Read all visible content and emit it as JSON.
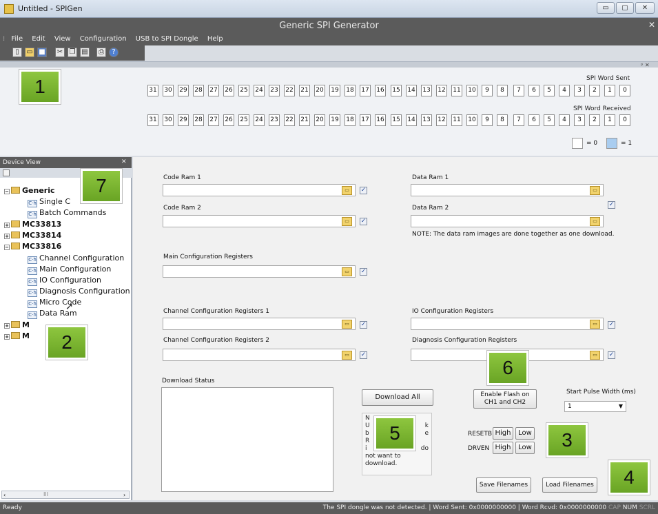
{
  "window": {
    "title": "Untitled - SPIGen",
    "app_title": "Generic SPI Generator",
    "min_label": "▭",
    "max_label": "▢",
    "close_label": "✕"
  },
  "menu": {
    "items": [
      "File",
      "Edit",
      "View",
      "Configuration",
      "USB to SPI Dongle",
      "Help"
    ]
  },
  "bits": {
    "sent_label": "SPI Word Sent",
    "received_label": "SPI Word Received",
    "groups": [
      [
        "31",
        "30",
        "29",
        "28",
        "27",
        "26",
        "25",
        "24"
      ],
      [
        "23",
        "22",
        "21",
        "20",
        "19",
        "18",
        "17",
        "16"
      ],
      [
        "15",
        "14",
        "13",
        "12",
        "11",
        "10",
        "9",
        "8"
      ],
      [
        "7",
        "6",
        "5",
        "4",
        "3",
        "2",
        "1",
        "0"
      ]
    ],
    "legend_zero": "= 0",
    "legend_one": "= 1",
    "legend_one_color": "#a9cdf0",
    "panel_pin": "ᵖ ✕"
  },
  "device_view": {
    "header": "Device View",
    "close": "✕",
    "scroll_thumb": "III",
    "tree": {
      "generic": "Generic",
      "single": "Single C",
      "batch": "Batch Commands",
      "mc33813": "MC33813",
      "mc33814": "MC33814",
      "mc33816": "MC33816",
      "channel_config": "Channel Configuration",
      "main_config": "Main Configuration",
      "io_config": "IO Configuration",
      "diag_config": "Diagnosis Configuration",
      "micro_code": "Micro Code",
      "data_ram": "Data Ram",
      "m1": "M",
      "m2": "M"
    }
  },
  "form": {
    "code_ram_1": "Code Ram 1",
    "code_ram_2": "Code Ram 2",
    "data_ram_1": "Data Ram 1",
    "data_ram_2": "Data Ram 2",
    "note": "NOTE: The data ram images are done together as one download.",
    "main_config_regs": "Main Configuration Registers",
    "channel_config_regs_1": "Channel Configuration Registers 1",
    "channel_config_regs_2": "Channel Configuration Registers 2",
    "io_config_regs": "IO Configuration Registers",
    "diag_config_regs": "Diagnosis Configuration Registers",
    "download_status": "Download Status",
    "download_all": "Download All",
    "enable_flash": "Enable Flash on CH1 and CH2",
    "start_pulse_label": "Start Pulse Width (ms)",
    "start_pulse_value": "1",
    "resetb": "RESETB",
    "drven": "DRVEN",
    "high": "High",
    "low": "Low",
    "save_filenames": "Save Filenames",
    "load_filenames": "Load Filenames",
    "note_box_lines": [
      "N",
      "U",
      "b",
      "R",
      "i",
      "not want to",
      "download."
    ],
    "note_box_right": [
      "k",
      "e",
      "",
      "do"
    ],
    "check_mark": "✓"
  },
  "callouts": [
    "1",
    "2",
    "3",
    "4",
    "5",
    "6",
    "7"
  ],
  "status": {
    "ready": "Ready",
    "dongle": "The SPI dongle was not detected.",
    "word_sent": "Word Sent: 0x0000000000",
    "word_rcvd": "Word Rcvd: 0x0000000000",
    "cap": "CAP",
    "num": "NUM",
    "scrl": "SCRL"
  }
}
